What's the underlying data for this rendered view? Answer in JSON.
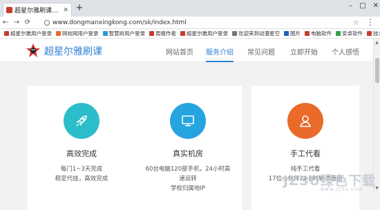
{
  "browser": {
    "tab_title": "超星尔雅刷课_智慧树",
    "new_tab": "+",
    "url": "www.dongmanxingkong.com/sk/index.html",
    "window_controls": [
      "–",
      "□",
      "✕"
    ],
    "bookmarks": [
      {
        "label": "超星尔雅用户登录",
        "color": "#c53d2f"
      },
      {
        "label": "网校网用户登录",
        "color": "#e86a2c"
      },
      {
        "label": "智慧树用户登录",
        "color": "#2b9ad6"
      },
      {
        "label": "周报作者",
        "color": "#c53d2f"
      },
      {
        "label": "超星尔雅用户登录",
        "color": "#c53d2f"
      },
      {
        "label": "欢迎来到动漫星空",
        "color": "#777777"
      },
      {
        "label": "图片",
        "color": "#1f63b8"
      },
      {
        "label": "电脑软件",
        "color": "#c53d2f"
      },
      {
        "label": "安卓软件",
        "color": "#33a04a"
      },
      {
        "label": "技术街",
        "color": "#c53d2f"
      },
      {
        "label": "游戏",
        "color": "#777777"
      }
    ]
  },
  "site": {
    "brand": "超星尔雅刷课",
    "nav": [
      {
        "label": "网站首页",
        "active": false
      },
      {
        "label": "服务介绍",
        "active": true
      },
      {
        "label": "常见问题",
        "active": false
      },
      {
        "label": "立即开始",
        "active": false
      },
      {
        "label": "个人感悟",
        "active": false
      }
    ],
    "accent": "#2d7fd9"
  },
  "cards": [
    {
      "title": "高效完成",
      "icon": "rocket-icon",
      "color": "#2bbdc9",
      "lines": [
        "每门1~3天完成",
        "稳定代挂，高效完成"
      ]
    },
    {
      "title": "真实机房",
      "icon": "monitor-icon",
      "color": "#25a4e0",
      "lines": [
        "60台电脑120部手机，24小时高",
        "速运转",
        "学校归属地IP"
      ]
    },
    {
      "title": "手工代看",
      "icon": "user-icon",
      "color": "#ea6a2a",
      "lines": [
        "纯手工代看",
        "17位小伙伴24小时轮流值班"
      ]
    }
  ],
  "watermark": {
    "main": "JZSU绿色下载",
    "sub": "www.jz5u.com"
  }
}
